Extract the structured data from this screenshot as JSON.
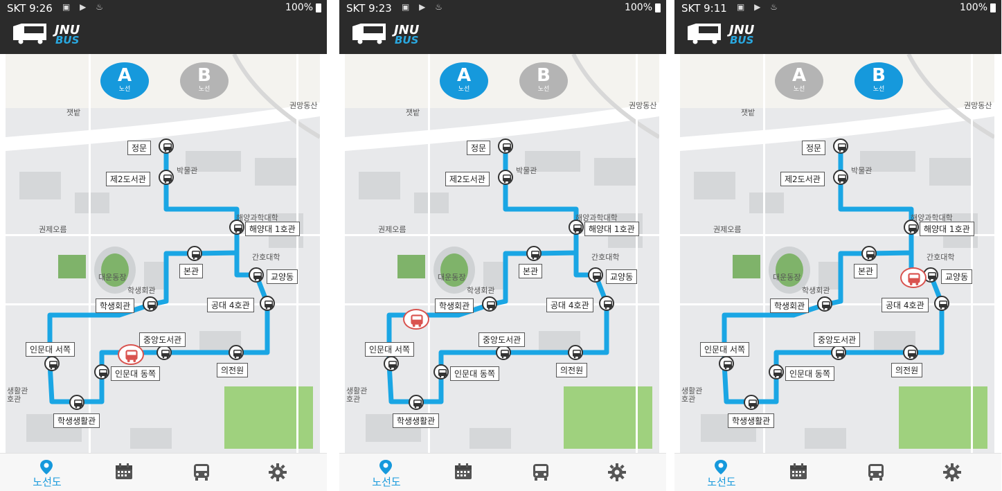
{
  "screens": [
    {
      "status": {
        "time": "SKT 9:26",
        "battery": "100%"
      },
      "app": {
        "logo_top": "JNU",
        "logo_bottom": "BUS"
      },
      "route_buttons": [
        {
          "letter": "A",
          "sub": "노선",
          "active": true
        },
        {
          "letter": "B",
          "sub": "노선",
          "active": false
        }
      ],
      "active_route": "A",
      "nav": {
        "routes_label": "노선도"
      }
    },
    {
      "status": {
        "time": "SKT 9:23",
        "battery": "100%"
      },
      "app": {
        "logo_top": "JNU",
        "logo_bottom": "BUS"
      },
      "route_buttons": [
        {
          "letter": "A",
          "sub": "노선",
          "active": true
        },
        {
          "letter": "B",
          "sub": "노선",
          "active": false
        }
      ],
      "active_route": "A",
      "nav": {
        "routes_label": "노선도"
      }
    },
    {
      "status": {
        "time": "SKT 9:11",
        "battery": "100%"
      },
      "app": {
        "logo_top": "JNU",
        "logo_bottom": "BUS"
      },
      "route_buttons": [
        {
          "letter": "A",
          "sub": "노선",
          "active": false
        },
        {
          "letter": "B",
          "sub": "노선",
          "active": true
        }
      ],
      "active_route": "B",
      "nav": {
        "routes_label": "노선도"
      }
    }
  ],
  "stops": [
    "정문",
    "제2도서관",
    "해양대 1호관",
    "본관",
    "교양동",
    "학생회관",
    "공대 4호관",
    "중앙도서관",
    "의전원",
    "인문대 서쪽",
    "인문대 동쪽",
    "학생생활관"
  ],
  "map_labels": {
    "field_1": "잿밭",
    "mountain_1": "권망동산",
    "mountain_2": "권제오름",
    "museum": "박물관",
    "marine_college": "해양과학대학",
    "nursing": "간호대학",
    "stadium": "대운동장",
    "student_hall": "학생회관",
    "dorm_1": "생활관",
    "dorm_2": "호관"
  },
  "bus_positions": [
    "between-inmundae-east-and-central-library",
    "between-inmundae-west-and-student-hall",
    "near-gyoyangdong"
  ],
  "colors": {
    "route": "#1aa6e4",
    "active_button": "#1699dc",
    "inactive_button": "#b4b4b4",
    "bus_marker": "#d9534f",
    "appbar": "#2b2b2b"
  },
  "icons": {
    "nav": [
      "map-pin-icon",
      "calendar-icon",
      "bus-icon",
      "gear-icon"
    ]
  }
}
